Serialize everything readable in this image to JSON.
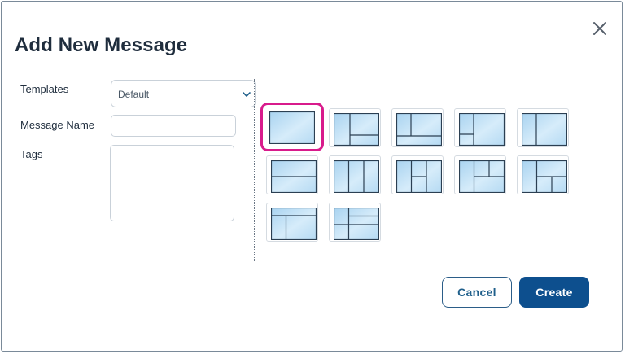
{
  "dialog": {
    "title": "Add New Message",
    "close_icon": "close-icon"
  },
  "form": {
    "templates_label": "Templates",
    "templates_value": "Default",
    "message_name_label": "Message Name",
    "message_name_value": "",
    "tags_label": "Tags",
    "tags_value": ""
  },
  "layouts": {
    "selected_index": 0,
    "count": 12,
    "highlight_color": "#d81b8c"
  },
  "buttons": {
    "cancel_label": "Cancel",
    "create_label": "Create"
  },
  "colors": {
    "primary": "#0d4f8e",
    "title": "#1f2d3d",
    "tile_fill": "#cfe6f5"
  }
}
